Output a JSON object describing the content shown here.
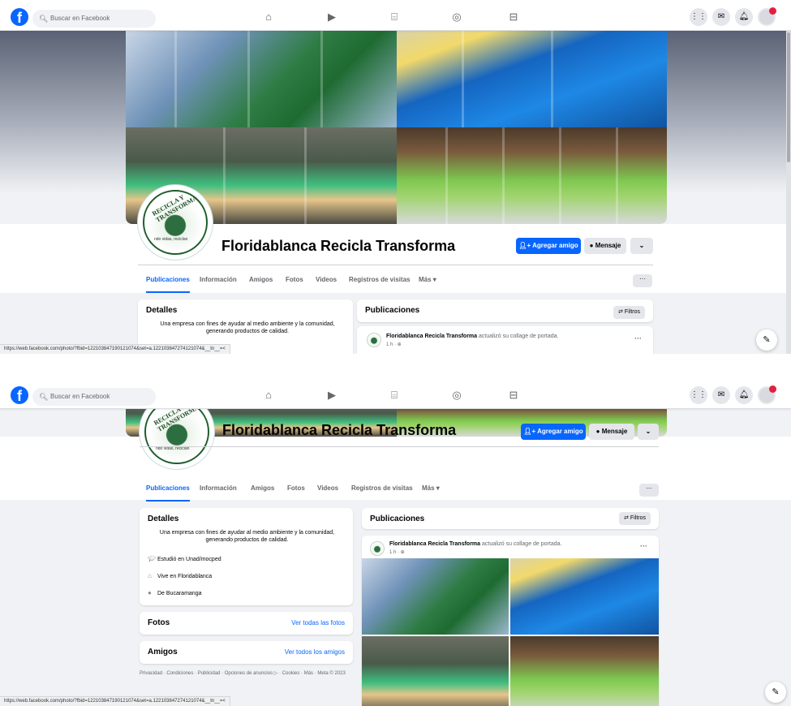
{
  "topbar": {
    "logo": "f",
    "search_placeholder": "Buscar en Facebook",
    "nav_icons": [
      "home-icon",
      "video-icon",
      "marketplace-icon",
      "groups-icon",
      "gaming-icon"
    ],
    "right_icons": [
      "menu-grid-icon",
      "messenger-icon",
      "notifications-icon",
      "account-icon"
    ]
  },
  "page": {
    "name": "Floridablanca Recicla Transforma",
    "profile_ring_text": "RECICLA Y TRANSFORMA",
    "profile_sub_text": "ndo vidas, reciclan",
    "add_friend_label": "Agregar amigo",
    "message_label": "Mensaje",
    "dropdown_label": "⌄",
    "tabs": [
      "Publicaciones",
      "Información",
      "Amigos",
      "Fotos",
      "Videos",
      "Registros de visitas",
      "Más ▾"
    ],
    "more_label": "···"
  },
  "details": {
    "title": "Detalles",
    "description": "Una empresa con fines de ayudar al medio ambiente y la comunidad, generando productos de calidad.",
    "studied": "Estudió en Unad/mocped",
    "lives": "Vive en Floridablanca",
    "from": "De Bucaramanga"
  },
  "photos": {
    "title": "Fotos",
    "link": "Ver todas las fotos"
  },
  "friends": {
    "title": "Amigos",
    "link": "Ver todos los amigos"
  },
  "footer": "Privacidad · Condiciones · Publicidad · Opciones de anuncios ▷ · Cookies · Más · Meta © 2023",
  "posts": {
    "title": "Publicaciones",
    "filters_label": "⇄ Filtros",
    "post_author": "Floridablanca Recicla Transforma",
    "post_action": " actualizó su collage de portada.",
    "post_time": "1 h · ⊕",
    "post_menu": "···"
  },
  "statusbar_url": "https://web.facebook.com/photo/?fbid=122103847190121074&set=a.122103847274121074&__tn__=<",
  "colors": {
    "accent": "#0866ff",
    "background": "#f0f2f5",
    "card": "#ffffff"
  }
}
